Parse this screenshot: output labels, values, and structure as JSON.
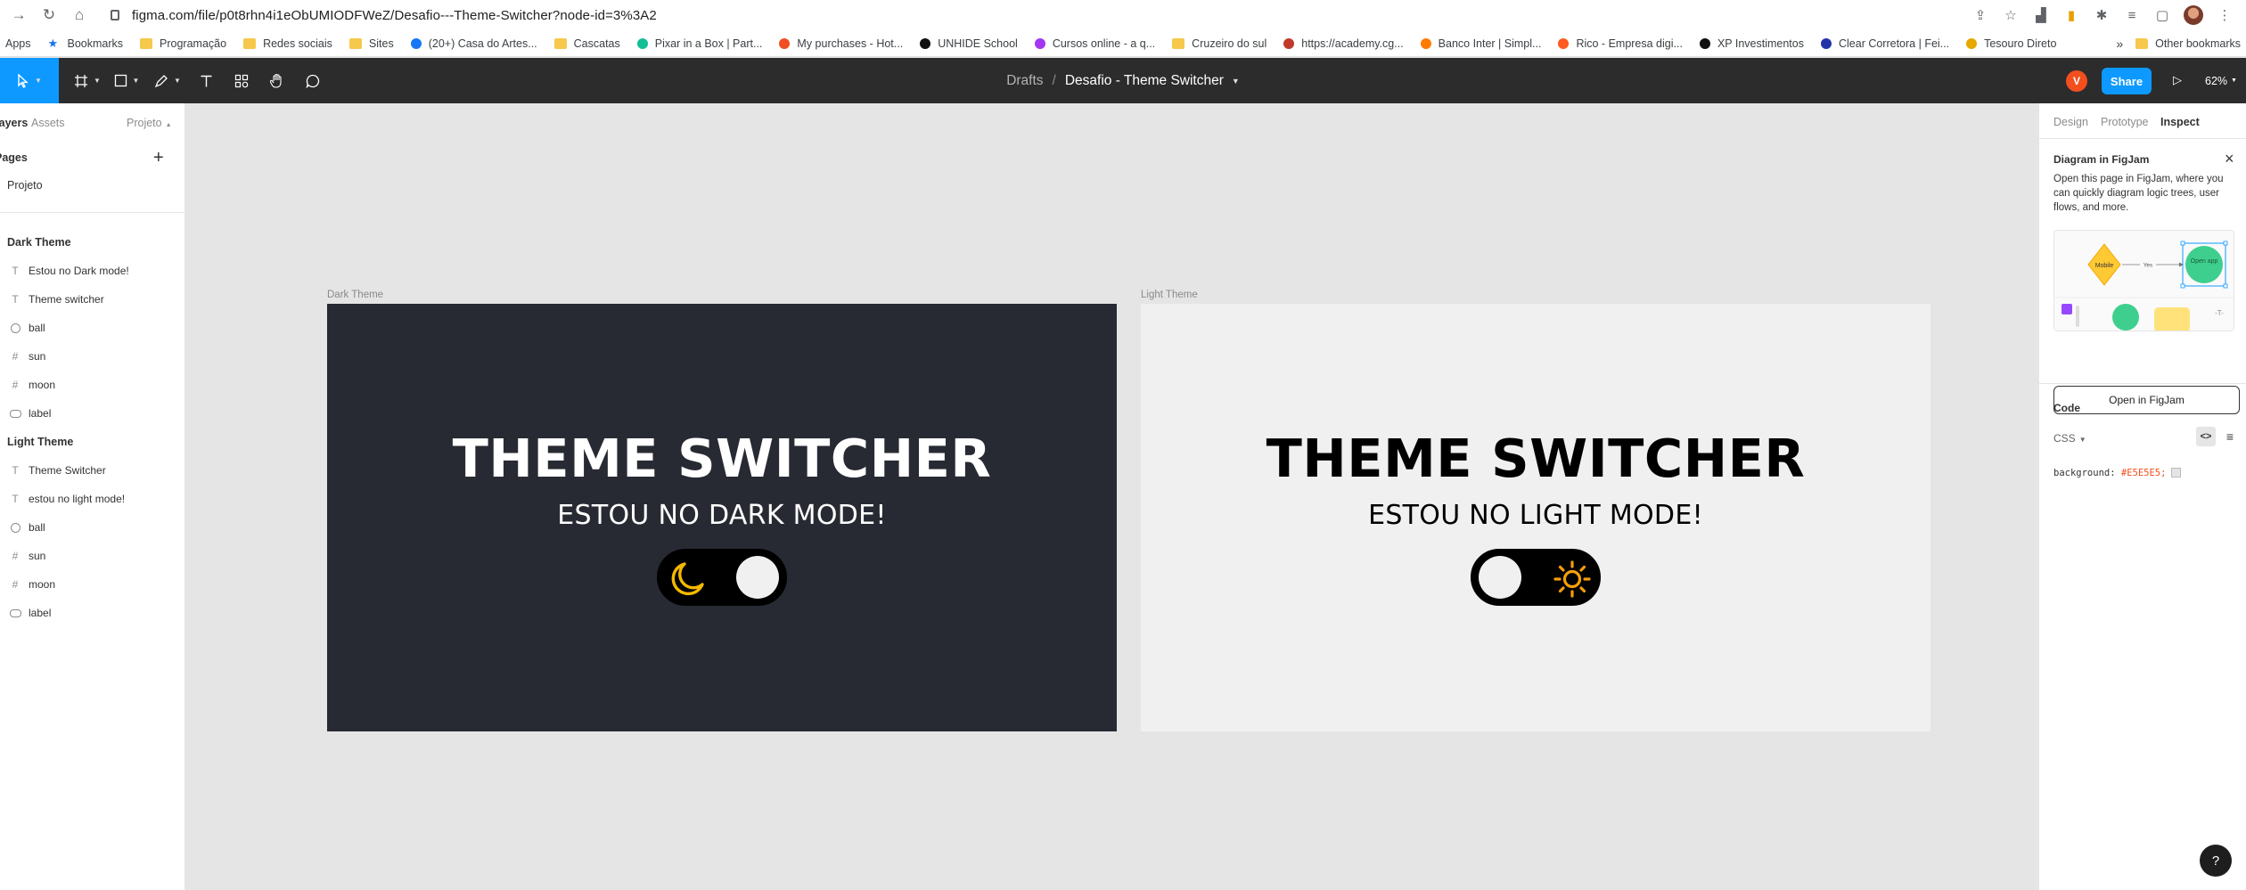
{
  "browser": {
    "url": "figma.com/file/p0t8rhn4i1eObUMIODFWeZ/Desafio---Theme-Switcher?node-id=3%3A2",
    "apps_label": "Apps",
    "bookmarks": [
      {
        "label": "Bookmarks",
        "icon": "star-icon",
        "color": "#1a73e8"
      },
      {
        "label": "Programação",
        "icon": "folder-icon",
        "color": "#f6c84c"
      },
      {
        "label": "Redes sociais",
        "icon": "folder-icon",
        "color": "#f6c84c"
      },
      {
        "label": "Sites",
        "icon": "folder-icon",
        "color": "#f6c84c"
      },
      {
        "label": "(20+) Casa do Artes...",
        "icon": "facebook-icon",
        "color": "#1877f2"
      },
      {
        "label": "Cascatas",
        "icon": "folder-icon",
        "color": "#f6c84c"
      },
      {
        "label": "Pixar in a Box | Part...",
        "icon": "khan-academy-icon",
        "color": "#14bf96"
      },
      {
        "label": "My purchases - Hot...",
        "icon": "hotmart-icon",
        "color": "#f04e23"
      },
      {
        "label": "UNHIDE School",
        "icon": "unhide-icon",
        "color": "#111111"
      },
      {
        "label": "Cursos online - a q...",
        "icon": "udemy-icon",
        "color": "#a435f0"
      },
      {
        "label": "Cruzeiro do sul",
        "icon": "folder-icon",
        "color": "#f6c84c"
      },
      {
        "label": "https://academy.cg...",
        "icon": "academy-icon",
        "color": "#c0392b"
      },
      {
        "label": "Banco Inter | Simpl...",
        "icon": "inter-icon",
        "color": "#ff7a00"
      },
      {
        "label": "Rico - Empresa digi...",
        "icon": "rico-icon",
        "color": "#ff5a1f"
      },
      {
        "label": "XP Investimentos",
        "icon": "xp-icon",
        "color": "#111111"
      },
      {
        "label": "Clear Corretora | Fei...",
        "icon": "clear-icon",
        "color": "#2233aa"
      },
      {
        "label": "Tesouro Direto",
        "icon": "tesouro-icon",
        "color": "#e6a700"
      }
    ],
    "other_bookmarks": "Other bookmarks",
    "more_chevron": "»"
  },
  "toolbar": {
    "breadcrumb_drafts": "Drafts",
    "breadcrumb_sep": "/",
    "file_name": "Desafio - Theme Switcher",
    "avatar_initial": "V",
    "share_label": "Share",
    "zoom": "62%"
  },
  "left_panel": {
    "tabs": [
      "Layers",
      "Assets"
    ],
    "page_dropdown": "Projeto",
    "pages_title": "Pages",
    "pages": [
      "Projeto"
    ],
    "layers": [
      {
        "name": "Dark Theme",
        "type": "frame"
      },
      {
        "name": "Estou no Dark mode!",
        "type": "text"
      },
      {
        "name": "Theme switcher",
        "type": "text"
      },
      {
        "name": "ball",
        "type": "ellipse"
      },
      {
        "name": "sun",
        "type": "frame-child"
      },
      {
        "name": "moon",
        "type": "frame-child"
      },
      {
        "name": "label",
        "type": "rect"
      },
      {
        "name": "Light Theme",
        "type": "frame"
      },
      {
        "name": "Theme Switcher",
        "type": "text"
      },
      {
        "name": "estou no light mode!",
        "type": "text"
      },
      {
        "name": "ball",
        "type": "ellipse"
      },
      {
        "name": "sun",
        "type": "frame-child"
      },
      {
        "name": "moon",
        "type": "frame-child"
      },
      {
        "name": "label",
        "type": "rect"
      }
    ]
  },
  "canvas": {
    "background": "#e5e5e5",
    "dark_frame": {
      "label": "Dark Theme",
      "title": "THEME SWITCHER",
      "subtitle": "ESTOU NO DARK MODE!",
      "background": "#282a33",
      "icon": "moon-icon",
      "icon_color": "#f5b800"
    },
    "light_frame": {
      "label": "Light Theme",
      "title": "THEME SWITCHER",
      "subtitle": "ESTOU NO LIGHT MODE!",
      "background": "#f0f0f0",
      "icon": "sun-icon",
      "icon_color": "#f59e0b"
    }
  },
  "right_panel": {
    "tabs": [
      "Design",
      "Prototype",
      "Inspect"
    ],
    "active_tab": "Inspect",
    "figjam": {
      "title": "Diagram in FigJam",
      "description": "Open this page in FigJam, where you can quickly diagram logic trees, user flows, and more.",
      "preview_mobile": "Mobile",
      "preview_yes": "Yes",
      "preview_open_app": "Open app",
      "button": "Open in FigJam"
    },
    "code": {
      "title": "Code",
      "language": "CSS",
      "property": "background:",
      "value": "#E5E5E5;"
    },
    "help": "?"
  }
}
